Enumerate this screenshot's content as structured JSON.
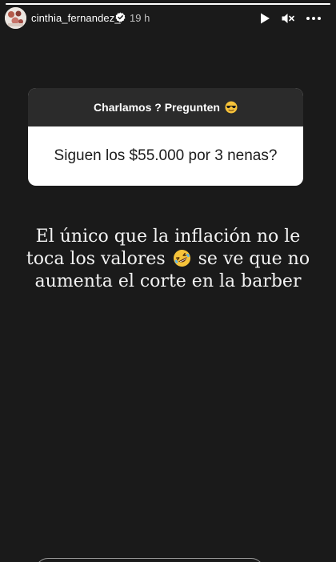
{
  "story": {
    "progress": 1.0,
    "colors": {
      "background": "#1a1a1a",
      "card_header": "#2b2b2b",
      "card_body": "#ffffff",
      "text": "#ffffff"
    }
  },
  "header": {
    "username": "cinthia_fernandez_",
    "time": "19 h",
    "icons": [
      "play-icon",
      "mute-icon",
      "more-icon",
      "verified-badge-icon"
    ]
  },
  "question_card": {
    "title": "Charlamos ? Pregunten",
    "title_emoji": "sunglasses-emoji",
    "question": "Siguen los $55.000 por 3 nenas?"
  },
  "caption": {
    "text_before_emoji": "El único que la inflación no le toca los valores",
    "emoji": "rolling-laughing-emoji",
    "text_after_emoji": "se ve que no aumenta el corte en la barber"
  }
}
